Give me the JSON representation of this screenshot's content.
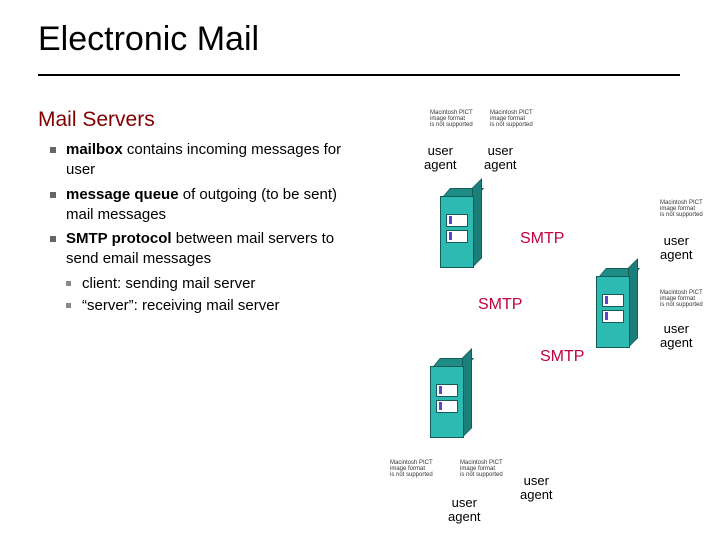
{
  "title": "Electronic Mail",
  "subheading": "Mail Servers",
  "bullets": {
    "b1_bold": "mailbox",
    "b1_rest": " contains incoming messages for user",
    "b2_bold": "message queue",
    "b2_rest": " of outgoing (to be sent) mail messages",
    "b3_bold": "SMTP protocol",
    "b3_rest": " between mail servers to send email messages",
    "b3a": "client: sending mail server",
    "b3b": "“server”: receiving mail server"
  },
  "labels": {
    "user_agent": "user\nagent",
    "smtp": "SMTP",
    "pict_missing": "Macintosh PICT\nimage format\nis not supported"
  }
}
